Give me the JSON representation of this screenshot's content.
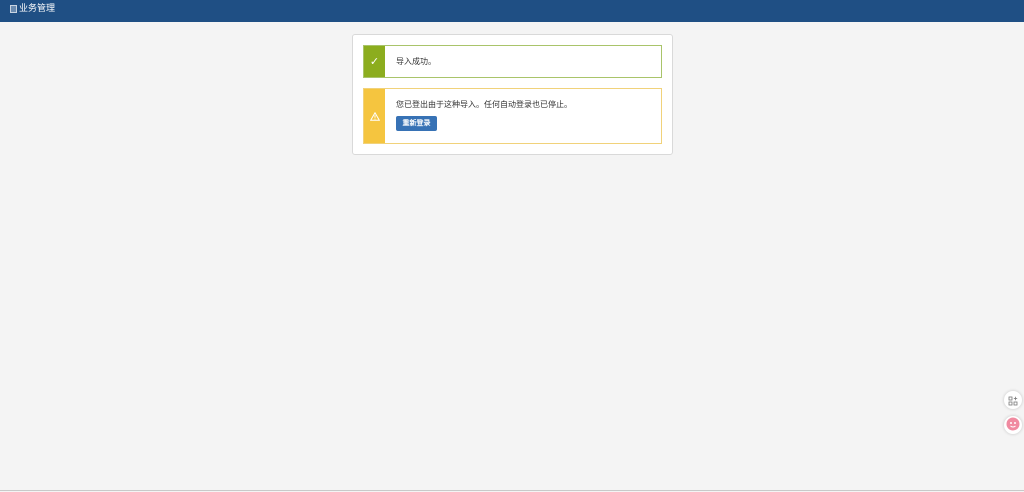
{
  "header": {
    "brand_alt": "业务管理",
    "background_color": "#1f4f84"
  },
  "success_message": {
    "icon": "check-icon",
    "text": "导入成功。",
    "color": "#8cad1e"
  },
  "warning_message": {
    "icon": "warning-triangle-icon",
    "text": "您已登出由于这种导入。任何自动登录也已停止。",
    "button_label": "重新登录",
    "color": "#f5c53f",
    "button_color": "#3772b5"
  },
  "floating_tools": {
    "apps_icon": "apps-grid-icon",
    "assistant_icon": "assistant-avatar-icon"
  }
}
